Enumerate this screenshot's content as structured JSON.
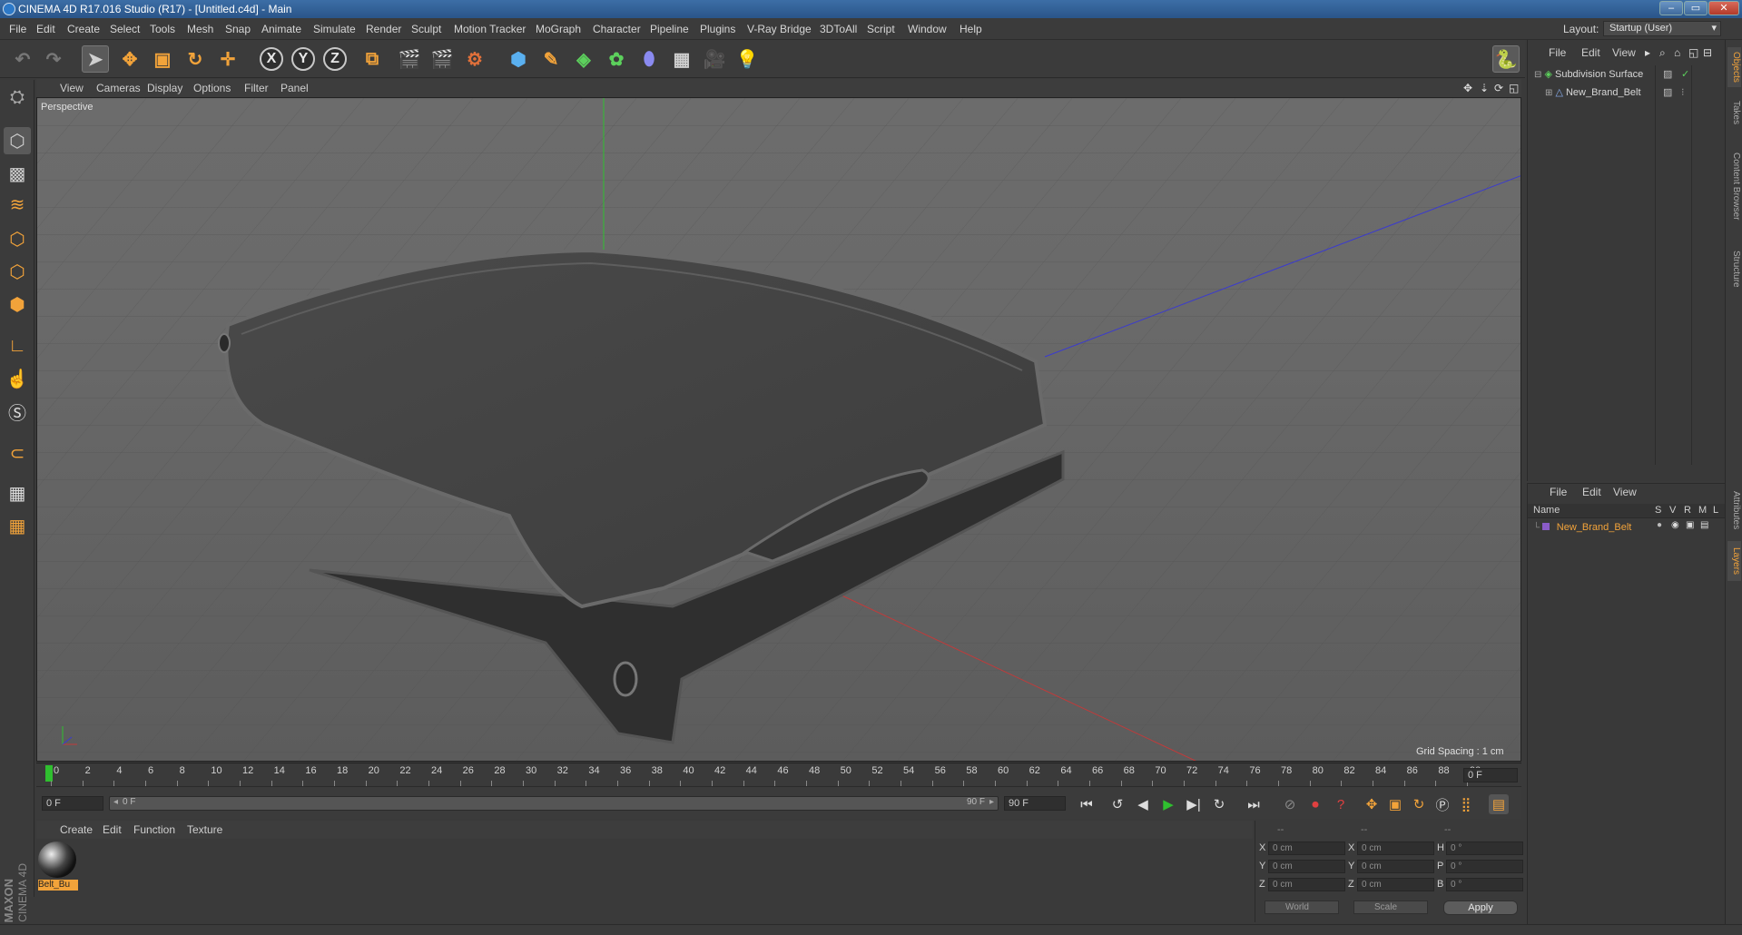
{
  "window": {
    "title": "CINEMA 4D R17.016 Studio (R17) - [Untitled.c4d] - Main",
    "buttons": [
      "–",
      "▭",
      "✕"
    ]
  },
  "menubar": {
    "items": [
      "File",
      "Edit",
      "Create",
      "Select",
      "Tools",
      "Mesh",
      "Snap",
      "Animate",
      "Simulate",
      "Render",
      "Sculpt",
      "Motion Tracker",
      "MoGraph",
      "Character",
      "Pipeline",
      "Plugins",
      "V-Ray Bridge",
      "3DToAll",
      "Script",
      "Window",
      "Help"
    ],
    "layout_label": "Layout:",
    "layout_value": "Startup (User)"
  },
  "toolbar": {
    "axis_x": "X",
    "axis_y": "Y",
    "axis_z": "Z"
  },
  "viewport": {
    "menu": [
      "View",
      "Cameras",
      "Display",
      "Options",
      "Filter",
      "Panel"
    ],
    "label": "Perspective",
    "grid_spacing": "Grid Spacing : 1 cm"
  },
  "timeline": {
    "ticks": [
      "0",
      "2",
      "4",
      "6",
      "8",
      "10",
      "12",
      "14",
      "16",
      "18",
      "20",
      "22",
      "24",
      "26",
      "28",
      "30",
      "32",
      "34",
      "36",
      "38",
      "40",
      "42",
      "44",
      "46",
      "48",
      "50",
      "52",
      "54",
      "56",
      "58",
      "60",
      "62",
      "64",
      "66",
      "68",
      "70",
      "72",
      "74",
      "76",
      "78",
      "80",
      "82",
      "84",
      "86",
      "88",
      "90"
    ],
    "current_frame": "0 F"
  },
  "transport": {
    "start_frame": "0 F",
    "slider_start": "0 F",
    "slider_end": "90 F",
    "end_frame": "90 F"
  },
  "material_panel": {
    "menu": [
      "Create",
      "Edit",
      "Function",
      "Texture"
    ],
    "material_name": "Belt_Bu"
  },
  "coordinates": {
    "header": [
      "--",
      "--",
      "--"
    ],
    "rows": [
      {
        "l1": "X",
        "v1": "0 cm",
        "l2": "X",
        "v2": "0 cm",
        "l3": "H",
        "v3": "0 °"
      },
      {
        "l1": "Y",
        "v1": "0 cm",
        "l2": "Y",
        "v2": "0 cm",
        "l3": "P",
        "v3": "0 °"
      },
      {
        "l1": "Z",
        "v1": "0 cm",
        "l2": "Z",
        "v2": "0 cm",
        "l3": "B",
        "v3": "0 °"
      }
    ],
    "mode_world": "World",
    "mode_scale": "Scale",
    "apply": "Apply"
  },
  "objects_panel": {
    "menu": [
      "File",
      "Edit",
      "View"
    ],
    "items": [
      "Subdivision Surface",
      "New_Brand_Belt"
    ]
  },
  "layers_panel": {
    "menu": [
      "File",
      "Edit",
      "View"
    ],
    "columns": [
      "Name",
      "S",
      "V",
      "R",
      "M",
      "L"
    ],
    "items": [
      "New_Brand_Belt"
    ]
  },
  "right_tabs": [
    "Objects",
    "Takes",
    "Content Browser",
    "Structure",
    "Attributes",
    "Layers"
  ],
  "branding": {
    "maxon": "MAXON",
    "cinema": "CINEMA 4D"
  },
  "colors": {
    "accent_orange": "#f2a33a",
    "selection_blue": "#5a8fd0",
    "axis_green": "#2fbf2f",
    "axis_red": "#c23a3a",
    "axis_blue": "#3a3ad0"
  }
}
